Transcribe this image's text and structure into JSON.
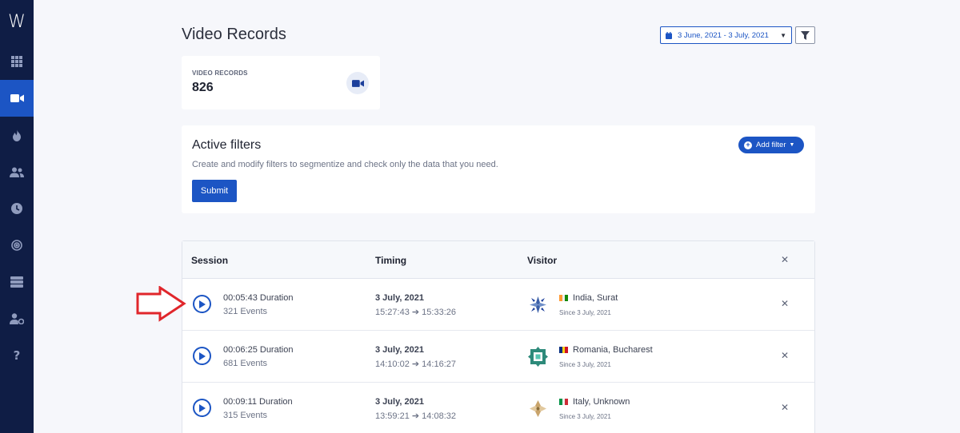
{
  "app": {
    "logo": "W"
  },
  "sidebar": {
    "items": [
      {
        "icon": "grid-icon",
        "active": false
      },
      {
        "icon": "video-icon",
        "active": true
      },
      {
        "icon": "fire-icon",
        "active": false
      },
      {
        "icon": "users-icon",
        "active": false
      },
      {
        "icon": "clock-icon",
        "active": false
      },
      {
        "icon": "target-icon",
        "active": false
      },
      {
        "icon": "server-icon",
        "active": false
      },
      {
        "icon": "user-settings-icon",
        "active": false
      },
      {
        "icon": "help-icon",
        "active": false
      }
    ]
  },
  "header": {
    "title": "Video Records",
    "date_range": "3 June, 2021 - 3 July, 2021"
  },
  "stats": {
    "label": "VIDEO RECORDS",
    "value": "826"
  },
  "filters": {
    "title": "Active filters",
    "description": "Create and modify filters to segmentize and check only the data that you need.",
    "submit_label": "Submit",
    "add_filter_label": "Add filter"
  },
  "table": {
    "columns": {
      "session": "Session",
      "timing": "Timing",
      "visitor": "Visitor"
    },
    "rows": [
      {
        "duration": "00:05:43 Duration",
        "events": "321 Events",
        "date": "3 July, 2021",
        "start": "15:27:43",
        "end": "15:33:26",
        "location": "India, Surat",
        "since": "Since 3 July, 2021",
        "flag": [
          "#ff9933",
          "#ffffff",
          "#138808"
        ]
      },
      {
        "duration": "00:06:25 Duration",
        "events": "681 Events",
        "date": "3 July, 2021",
        "start": "14:10:02",
        "end": "14:16:27",
        "location": "Romania, Bucharest",
        "since": "Since 3 July, 2021",
        "flag": [
          "#002b7f",
          "#fcd116",
          "#ce1126"
        ]
      },
      {
        "duration": "00:09:11 Duration",
        "events": "315 Events",
        "date": "3 July, 2021",
        "start": "13:59:21",
        "end": "14:08:32",
        "location": "Italy, Unknown",
        "since": "Since 3 July, 2021",
        "flag": [
          "#009246",
          "#ffffff",
          "#ce2b37"
        ]
      }
    ]
  },
  "colors": {
    "accent": "#1c55c4",
    "sidebar": "#0f1d45",
    "annotation": "#e0262b"
  }
}
